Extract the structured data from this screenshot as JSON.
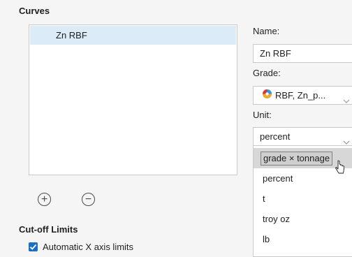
{
  "curves": {
    "heading": "Curves",
    "items": [
      {
        "label": "Zn RBF"
      }
    ]
  },
  "form": {
    "name_label": "Name:",
    "name_value": "Zn RBF",
    "grade_label": "Grade:",
    "grade_value": "RBF, Zn_p...",
    "unit_label": "Unit:",
    "unit_value": "percent",
    "unit_options": [
      "grade × tonnage",
      "percent",
      "t",
      "troy oz",
      "lb"
    ],
    "highlighted_option": "grade × tonnage"
  },
  "buttons": {
    "add_symbol": "+",
    "remove_symbol": "−"
  },
  "cutoff": {
    "heading": "Cut-off Limits",
    "auto_x_label": "Automatic X axis limits",
    "auto_x_checked": true
  },
  "colors": {
    "accent": "#1a6fc4",
    "selection": "#dcebf8"
  },
  "icons": [
    "plus-circle-icon",
    "minus-circle-icon",
    "chevron-down-icon",
    "grade-color-icon",
    "checkmark-icon",
    "mouse-pointer-icon"
  ]
}
